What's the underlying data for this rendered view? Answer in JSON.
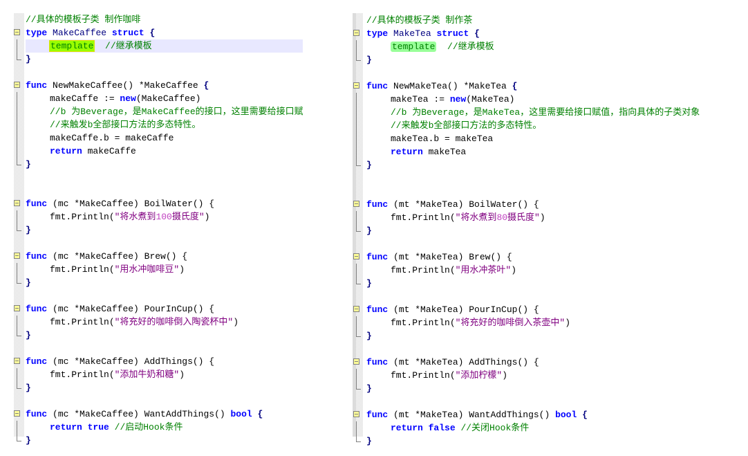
{
  "left_panel": {
    "header_comment": "//具体的模板子类 制作咖啡",
    "struct": {
      "kw_type": "type",
      "name": "MakeCaffee",
      "kw_struct": "struct",
      "open": "{",
      "field": "template",
      "field_comment": "//继承模板",
      "close": "}"
    },
    "ctor": {
      "kw_func": "func",
      "signature": "NewMakeCaffee() *MakeCaffee",
      "open": "{",
      "line1_var": "makeCaffe := ",
      "line1_kw": "new",
      "line1_rest": "(MakeCaffee)",
      "comment1": "//b 为Beverage，是MakeCaffee的接口，这里需要给接口赋值，指向具体的子类对象",
      "comment2": "//来触发b全部接口方法的多态特性。",
      "assign": "makeCaffe.b = makeCaffe",
      "kw_return": "return",
      "return_val": "makeCaffe",
      "close": "}"
    },
    "methods": [
      {
        "receiver": "(mc *MakeCaffee) BoilWater() {",
        "call": "fmt.Println(",
        "str_a": "\"将水煮到",
        "num": "100",
        "str_b": "摄氏度\"",
        "end": ")"
      },
      {
        "receiver": "(mc *MakeCaffee) Brew() {",
        "call": "fmt.Println(",
        "str_a": "\"用水冲咖啡豆\"",
        "num": "",
        "str_b": "",
        "end": ")"
      },
      {
        "receiver": "(mc *MakeCaffee) PourInCup() {",
        "call": "fmt.Println(",
        "str_a": "\"将充好的咖啡倒入陶瓷杯中\"",
        "num": "",
        "str_b": "",
        "end": ")"
      },
      {
        "receiver": "(mc *MakeCaffee) AddThings() {",
        "call": "fmt.Println(",
        "str_a": "\"添加牛奶和糖\"",
        "num": "",
        "str_b": "",
        "end": ")"
      }
    ],
    "want": {
      "receiver": "(mc *MakeCaffee) WantAddThings() ",
      "kw_bool": "bool",
      "open": "{",
      "kw_return": "return",
      "kw_val": "true",
      "comment": "//启动Hook条件",
      "close": "}"
    }
  },
  "right_panel": {
    "header_comment": "//具体的模板子类 制作茶",
    "struct": {
      "kw_type": "type",
      "name": "MakeTea",
      "kw_struct": "struct",
      "open": "{",
      "field": "template",
      "field_comment": "//继承模板",
      "close": "}"
    },
    "ctor": {
      "kw_func": "func",
      "signature": "NewMakeTea() *MakeTea",
      "open": "{",
      "line1_var": "makeTea := ",
      "line1_kw": "new",
      "line1_rest": "(MakeTea)",
      "comment1": "//b 为Beverage，是MakeTea，这里需要给接口赋值，指向具体的子类对象",
      "comment2": "//来触发b全部接口方法的多态特性。",
      "assign": "makeTea.b = makeTea",
      "kw_return": "return",
      "return_val": "makeTea",
      "close": "}"
    },
    "methods": [
      {
        "receiver": "(mt *MakeTea) BoilWater() {",
        "call": "fmt.Println(",
        "str_a": "\"将水煮到",
        "num": "80",
        "str_b": "摄氏度\"",
        "end": ")"
      },
      {
        "receiver": "(mt *MakeTea) Brew() {",
        "call": "fmt.Println(",
        "str_a": "\"用水冲茶叶\"",
        "num": "",
        "str_b": "",
        "end": ")"
      },
      {
        "receiver": "(mt *MakeTea) PourInCup() {",
        "call": "fmt.Println(",
        "str_a": "\"将充好的咖啡倒入茶壶中\"",
        "num": "",
        "str_b": "",
        "end": ")"
      },
      {
        "receiver": "(mt *MakeTea) AddThings() {",
        "call": "fmt.Println(",
        "str_a": "\"添加柠檬\"",
        "num": "",
        "str_b": "",
        "end": ")"
      }
    ],
    "want": {
      "receiver": "(mt *MakeTea) WantAddThings() ",
      "kw_bool": "bool",
      "open": "{",
      "kw_return": "return",
      "kw_val": "false",
      "comment": "//关闭Hook条件",
      "close": "}"
    }
  },
  "common": {
    "kw_func": "func"
  }
}
